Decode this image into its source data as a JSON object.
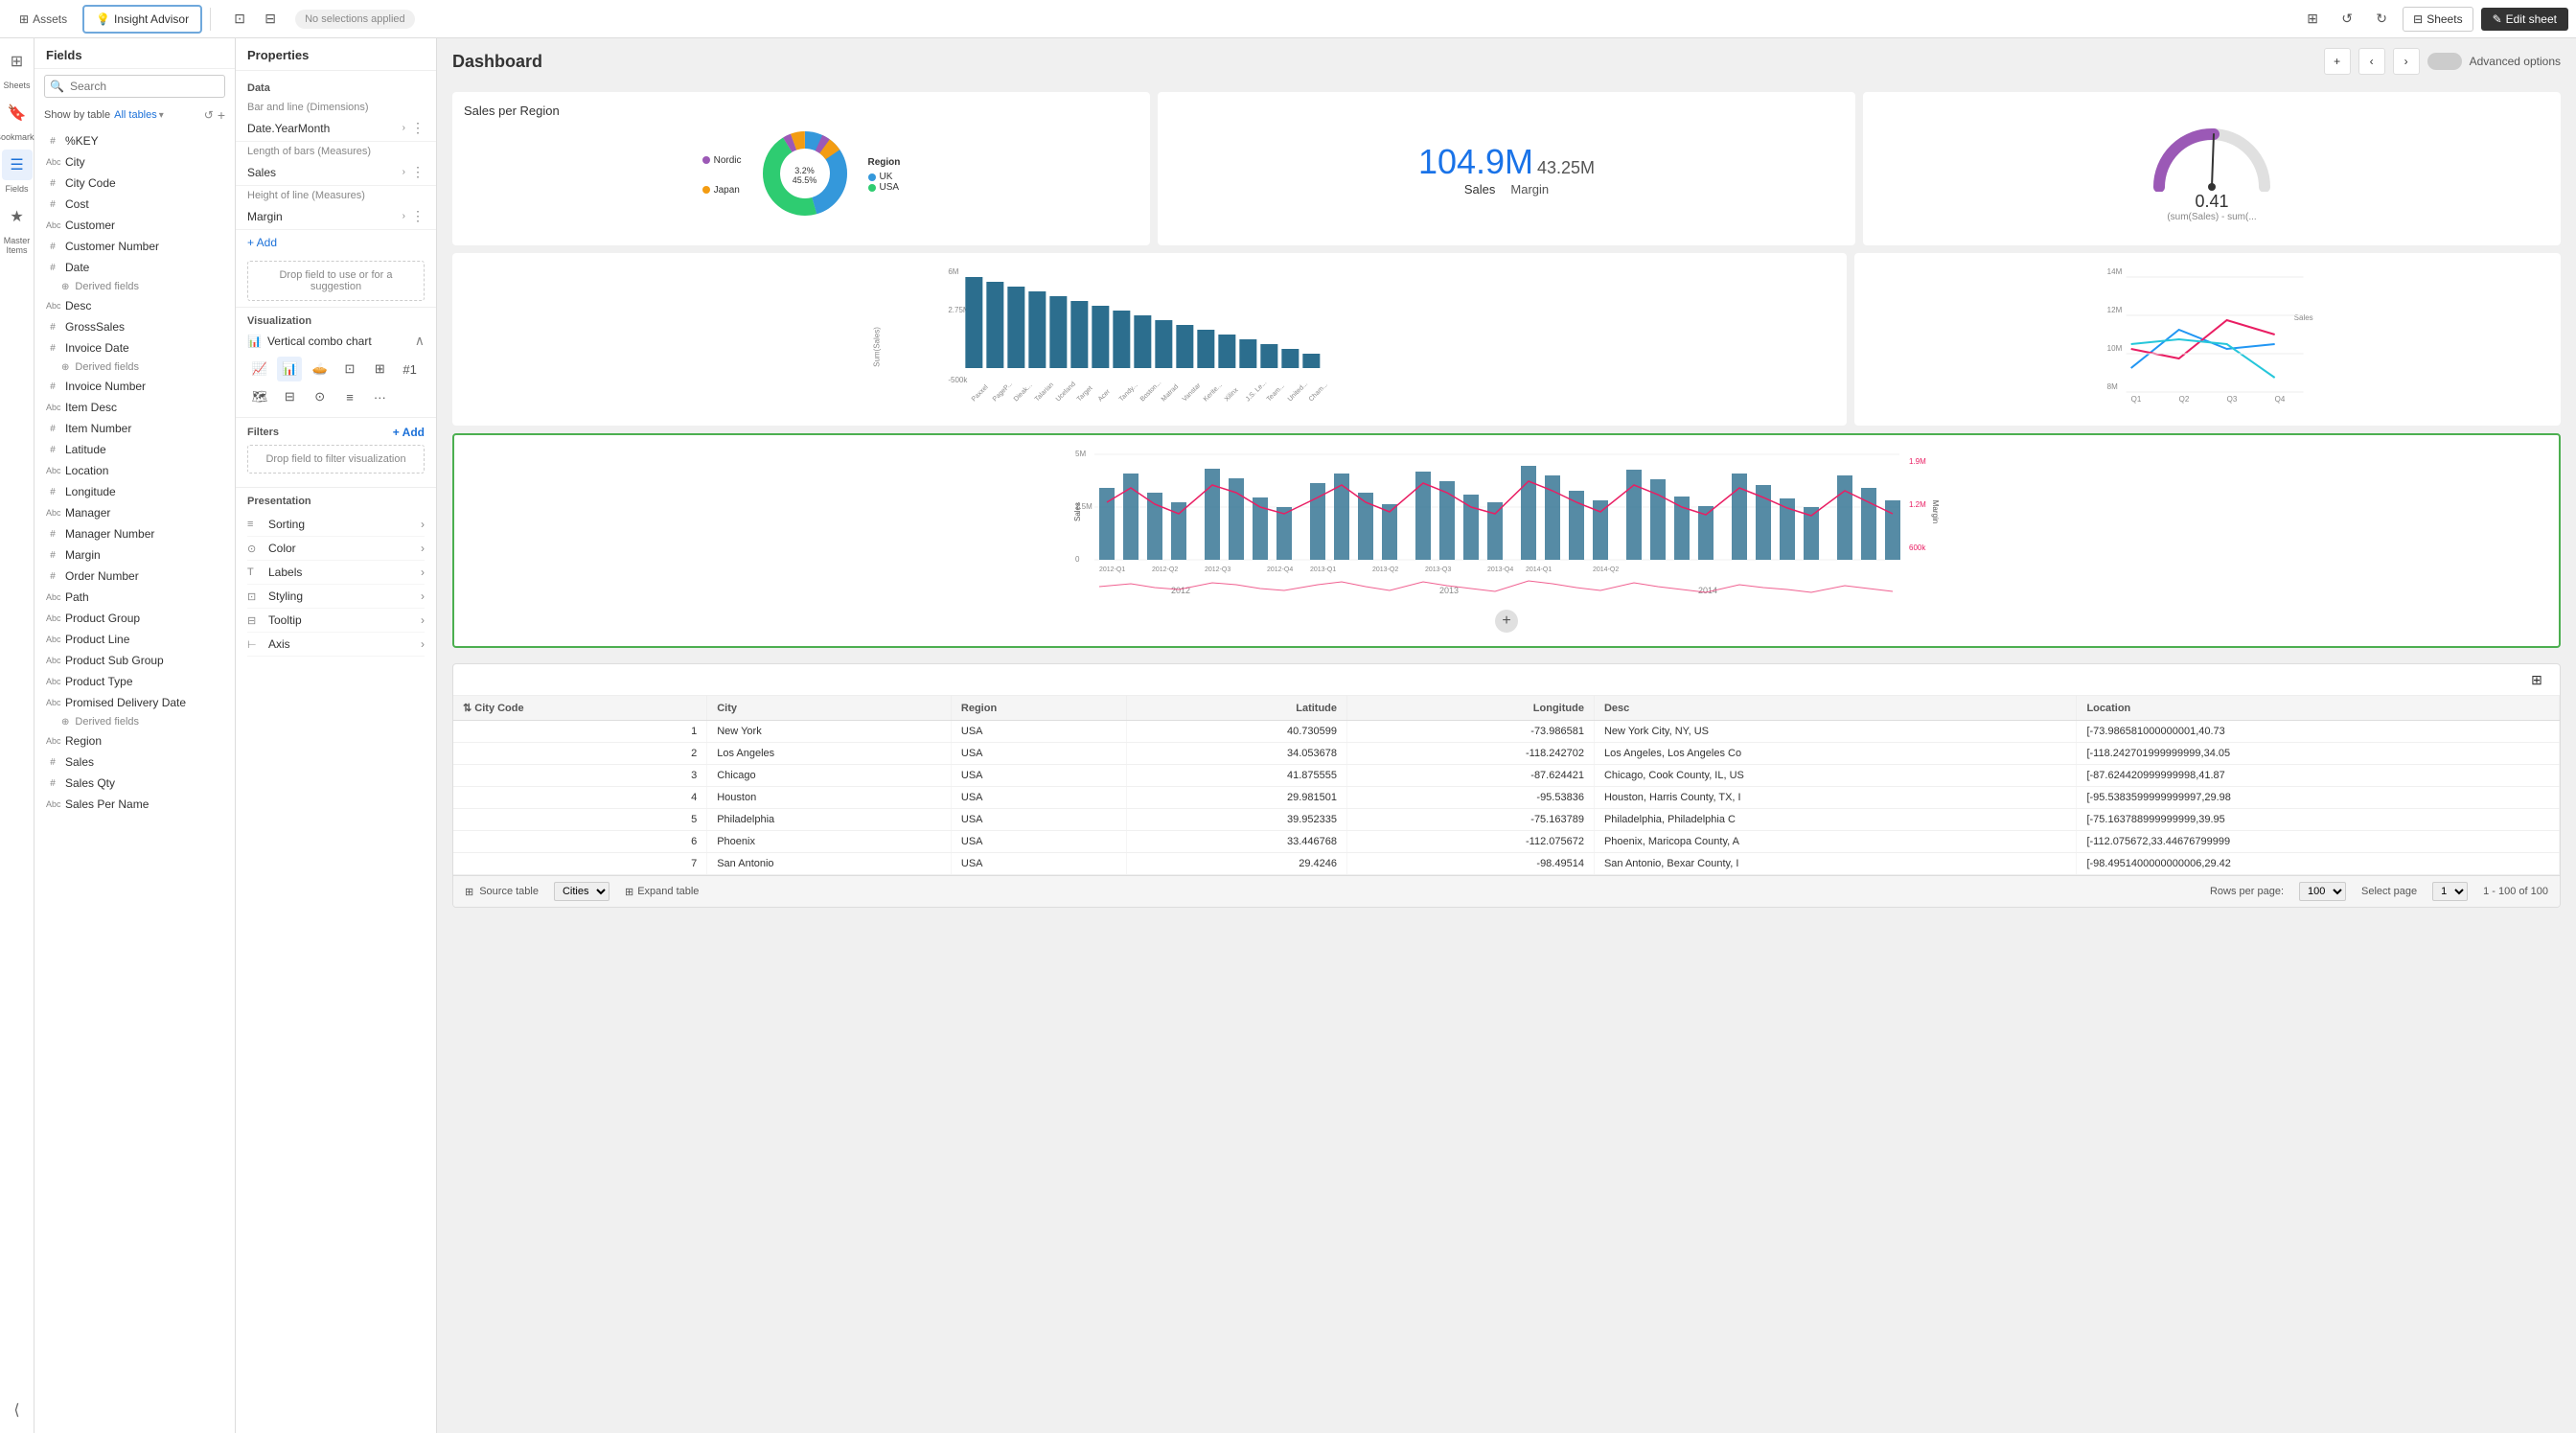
{
  "topbar": {
    "assets_label": "Assets",
    "insight_label": "Insight Advisor",
    "no_selections": "No selections applied",
    "sheets_label": "Sheets",
    "edit_sheet_label": "Edit sheet"
  },
  "sidebar": {
    "items": [
      {
        "id": "sheets",
        "label": "Sheets",
        "icon": "⊞"
      },
      {
        "id": "bookmarks",
        "label": "Bookmarks",
        "icon": "🔖"
      },
      {
        "id": "fields",
        "label": "Fields",
        "icon": "⊟"
      },
      {
        "id": "master-items",
        "label": "Master Items",
        "icon": "★"
      }
    ]
  },
  "fields_panel": {
    "title": "Fields",
    "search_placeholder": "Search",
    "show_by_label": "Show by table",
    "table_option": "All tables",
    "fields": [
      {
        "type": "#",
        "name": "%KEY"
      },
      {
        "type": "Abc",
        "name": "City"
      },
      {
        "type": "#",
        "name": "City Code"
      },
      {
        "type": "#",
        "name": "Cost"
      },
      {
        "type": "Abc",
        "name": "Customer"
      },
      {
        "type": "#",
        "name": "Customer Number"
      },
      {
        "type": "#",
        "name": "Date"
      },
      {
        "type": "derived",
        "name": "Derived fields"
      },
      {
        "type": "Abc",
        "name": "Desc"
      },
      {
        "type": "#",
        "name": "GrossSales"
      },
      {
        "type": "#",
        "name": "Invoice Date"
      },
      {
        "type": "derived",
        "name": "Derived fields"
      },
      {
        "type": "#",
        "name": "Invoice Number"
      },
      {
        "type": "Abc",
        "name": "Item Desc"
      },
      {
        "type": "#",
        "name": "Item Number"
      },
      {
        "type": "#",
        "name": "Latitude"
      },
      {
        "type": "Abc",
        "name": "Location"
      },
      {
        "type": "#",
        "name": "Longitude"
      },
      {
        "type": "Abc",
        "name": "Manager"
      },
      {
        "type": "#",
        "name": "Manager Number"
      },
      {
        "type": "#",
        "name": "Margin"
      },
      {
        "type": "#",
        "name": "Order Number"
      },
      {
        "type": "Abc",
        "name": "Path"
      },
      {
        "type": "Abc",
        "name": "Product Group"
      },
      {
        "type": "Abc",
        "name": "Product Line"
      },
      {
        "type": "Abc",
        "name": "Product Sub Group"
      },
      {
        "type": "Abc",
        "name": "Product Type"
      },
      {
        "type": "Abc",
        "name": "Promised Delivery Date"
      },
      {
        "type": "derived",
        "name": "Derived fields"
      },
      {
        "type": "Abc",
        "name": "Region"
      },
      {
        "type": "#",
        "name": "Sales"
      },
      {
        "type": "#",
        "name": "Sales Qty"
      },
      {
        "type": "Abc",
        "name": "Sales Per Name"
      }
    ]
  },
  "properties_panel": {
    "title": "Properties",
    "data_section": "Data",
    "bar_line_label": "Bar and line (Dimensions)",
    "bar_line_value": "Date.YearMonth",
    "length_bars_label": "Length of bars (Measures)",
    "length_bars_value": "Sales",
    "height_line_label": "Height of line (Measures)",
    "height_line_value": "Margin",
    "add_label": "+ Add",
    "drop_hint": "Drop field to use or for a suggestion",
    "visualization_label": "Visualization",
    "viz_type": "Vertical combo chart",
    "filters_label": "Filters",
    "add_filter": "+ Add",
    "drop_filter": "Drop field to filter visualization",
    "presentation_label": "Presentation",
    "pres_items": [
      {
        "icon": "sort",
        "label": "Sorting",
        "arrow": "›"
      },
      {
        "icon": "color",
        "label": "Color",
        "arrow": "›"
      },
      {
        "icon": "T",
        "label": "Labels",
        "arrow": "›"
      },
      {
        "icon": "style",
        "label": "Styling",
        "arrow": "›"
      },
      {
        "icon": "tooltip",
        "label": "Tooltip",
        "arrow": "›"
      },
      {
        "icon": "axis",
        "label": "Axis",
        "arrow": "›"
      }
    ]
  },
  "dashboard": {
    "title": "Dashboard",
    "advanced_options": "Advanced options"
  },
  "donut_chart": {
    "title": "Sales per Region",
    "legend_label": "Region",
    "segments": [
      {
        "label": "Nordic",
        "color": "#9c59b6",
        "value": 3.2
      },
      {
        "label": "Japan",
        "color": "#f39c12",
        "value": 5.5
      },
      {
        "label": "UK",
        "color": "#3498db",
        "value": 45.5
      },
      {
        "label": "USA",
        "color": "#2ecc71",
        "value": 45.8
      }
    ],
    "center_pct": "45.5%",
    "uk_pct": "3.2%"
  },
  "kpi_card": {
    "main_value": "104.9M",
    "sub_value": "43.25M",
    "label": "Sales",
    "sub_label": "Margin"
  },
  "gauge_card": {
    "value": "0.41",
    "sub_text": "(sum(Sales) - sum(...",
    "min": "0",
    "max": "100"
  },
  "bar_chart": {
    "y_label": "Sum(Sales)",
    "y_max": "6M",
    "y_mid": "2.75M",
    "y_neg": "-500k",
    "bars": [
      {
        "label": "Paxxel",
        "height": 85
      },
      {
        "label": "PageP...",
        "height": 78
      },
      {
        "label": "Dieak...",
        "height": 72
      },
      {
        "label": "Talarian",
        "height": 68
      },
      {
        "label": "Uceland",
        "height": 64
      },
      {
        "label": "Target",
        "height": 60
      },
      {
        "label": "Acer",
        "height": 55
      },
      {
        "label": "Tandy...",
        "height": 50
      },
      {
        "label": "Boston...",
        "height": 46
      },
      {
        "label": "Matrad",
        "height": 42
      },
      {
        "label": "Vanstar",
        "height": 38
      },
      {
        "label": "Kerite...",
        "height": 34
      },
      {
        "label": "Xilinx",
        "height": 30
      },
      {
        "label": "J.S. Le...",
        "height": 26
      },
      {
        "label": "Team...",
        "height": 22
      },
      {
        "label": "United...",
        "height": 18
      },
      {
        "label": "Cham...",
        "height": 14
      }
    ]
  },
  "line_chart": {
    "y_max": "14M",
    "y_mid": "12M",
    "y_min": "10M",
    "y_val": "8M",
    "label": "Sales",
    "quarters": [
      "Q1",
      "Q2",
      "Q3",
      "Q4"
    ]
  },
  "combo_chart": {
    "y_max": "5M",
    "y_mid": "2.5M",
    "y_zero": "0",
    "r_max": "1.9M",
    "r_mid": "1.2M",
    "r_min": "600k",
    "x_labels": [
      "2012-Q1",
      "2012-Q2",
      "2012-Q3",
      "2012-Q4",
      "2013-Q1",
      "2013-Q2",
      "2013-Q3",
      "2013-Q4",
      "2014-Q1",
      "2014-Q2"
    ],
    "year_labels": [
      "2012",
      "2013",
      "2014"
    ],
    "left_label": "Sales",
    "right_label": "Margin"
  },
  "data_table": {
    "columns": [
      "City Code",
      "City",
      "Region",
      "Latitude",
      "Longitude",
      "Desc",
      "Location"
    ],
    "rows": [
      {
        "city_code": "1",
        "city": "New York",
        "region": "USA",
        "latitude": "40.730599",
        "longitude": "-73.986581",
        "desc": "New York City, NY, US",
        "location": "[-73.986581000000001,40.73"
      },
      {
        "city_code": "2",
        "city": "Los Angeles",
        "region": "USA",
        "latitude": "34.053678",
        "longitude": "-118.242702",
        "desc": "Los Angeles, Los Angeles Co",
        "location": "[-118.242701999999999,34.05"
      },
      {
        "city_code": "3",
        "city": "Chicago",
        "region": "USA",
        "latitude": "41.875555",
        "longitude": "-87.624421",
        "desc": "Chicago, Cook County, IL, US",
        "location": "[-87.624420999999998,41.87"
      },
      {
        "city_code": "4",
        "city": "Houston",
        "region": "USA",
        "latitude": "29.981501",
        "longitude": "-95.53836",
        "desc": "Houston, Harris County, TX, I",
        "location": "[-95.5383599999999997,29.98"
      },
      {
        "city_code": "5",
        "city": "Philadelphia",
        "region": "USA",
        "latitude": "39.952335",
        "longitude": "-75.163789",
        "desc": "Philadelphia, Philadelphia C",
        "location": "[-75.163788999999999,39.95"
      },
      {
        "city_code": "6",
        "city": "Phoenix",
        "region": "USA",
        "latitude": "33.446768",
        "longitude": "-112.075672",
        "desc": "Phoenix, Maricopa County, A",
        "location": "[-112.075672,33.44676799999"
      },
      {
        "city_code": "7",
        "city": "San Antonio",
        "region": "USA",
        "latitude": "29.4246",
        "longitude": "-98.49514",
        "desc": "San Antonio, Bexar County, I",
        "location": "[-98.4951400000000006,29.42"
      }
    ],
    "source_label": "Source table",
    "source_table": "Cities",
    "expand_label": "Expand table",
    "rows_per_page": "100",
    "select_page": "1",
    "page_info": "1 - 100 of 100"
  }
}
